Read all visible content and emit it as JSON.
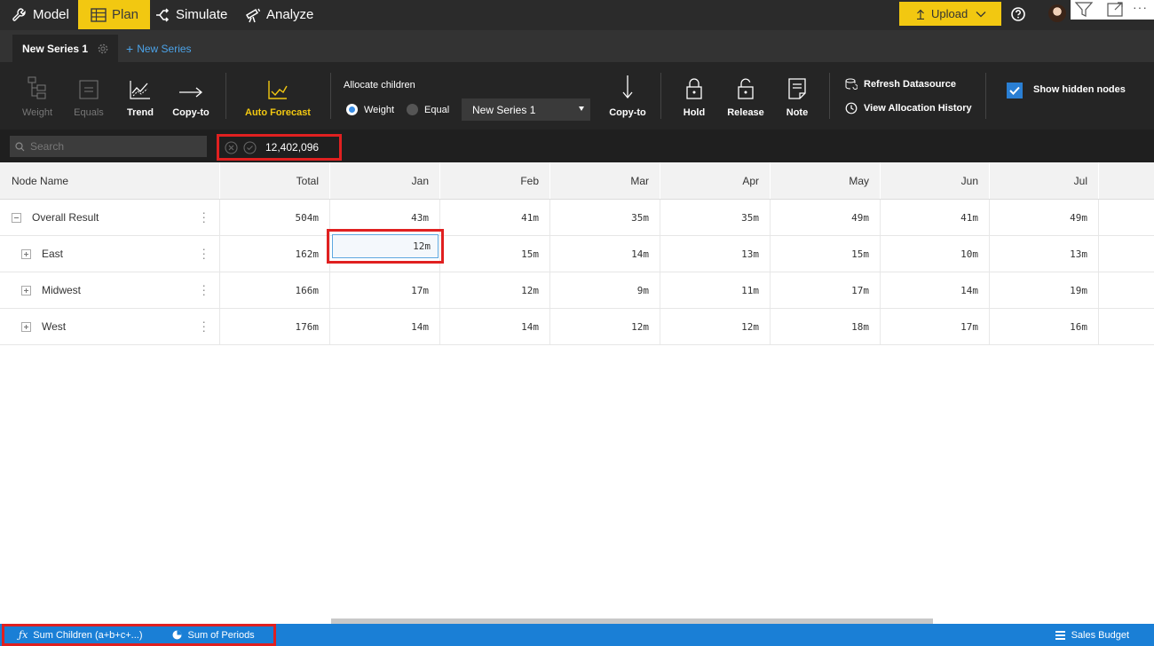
{
  "nav": {
    "items": [
      {
        "label": "Model",
        "icon": "wrench-icon"
      },
      {
        "label": "Plan",
        "icon": "table-icon",
        "active": true
      },
      {
        "label": "Simulate",
        "icon": "simulate-icon"
      },
      {
        "label": "Analyze",
        "icon": "telescope-icon"
      }
    ],
    "upload_label": "Upload",
    "accent": "#f2c811"
  },
  "series_tabs": {
    "active": "New Series 1",
    "new": "New Series"
  },
  "ribbon": {
    "weight": "Weight",
    "equals": "Equals",
    "trend": "Trend",
    "copy_to": "Copy-to",
    "auto_forecast": "Auto Forecast",
    "allocate_title": "Allocate children",
    "radio_weight": "Weight",
    "radio_equal": "Equal",
    "series_select": "New Series 1",
    "copy_to_2": "Copy-to",
    "hold": "Hold",
    "release": "Release",
    "note": "Note",
    "refresh": "Refresh Datasource",
    "history": "View Allocation History",
    "show_hidden": "Show hidden nodes"
  },
  "searchbar": {
    "placeholder": "Search",
    "edit_value": "12,402,096"
  },
  "grid": {
    "headers": {
      "name": "Node Name",
      "total": "Total",
      "m1": "Jan",
      "m2": "Feb",
      "m3": "Mar",
      "m4": "Apr",
      "m5": "May",
      "m6": "Jun",
      "m7": "Jul"
    },
    "rows": [
      {
        "name": "Overall Result",
        "total": "504m",
        "m1": "43m",
        "m2": "41m",
        "m3": "35m",
        "m4": "35m",
        "m5": "49m",
        "m6": "41m",
        "m7": "49m"
      },
      {
        "name": "East",
        "total": "162m",
        "m1": "12m",
        "m2": "15m",
        "m3": "14m",
        "m4": "13m",
        "m5": "15m",
        "m6": "10m",
        "m7": "13m"
      },
      {
        "name": "Midwest",
        "total": "166m",
        "m1": "17m",
        "m2": "12m",
        "m3": "9m",
        "m4": "11m",
        "m5": "17m",
        "m6": "14m",
        "m7": "19m"
      },
      {
        "name": "West",
        "total": "176m",
        "m1": "14m",
        "m2": "14m",
        "m3": "12m",
        "m4": "12m",
        "m5": "18m",
        "m6": "17m",
        "m7": "16m"
      }
    ]
  },
  "status": {
    "fx_label": "Sum Children (a+b+c+...)",
    "periods_label": "Sum of Periods",
    "dataset": "Sales Budget"
  }
}
